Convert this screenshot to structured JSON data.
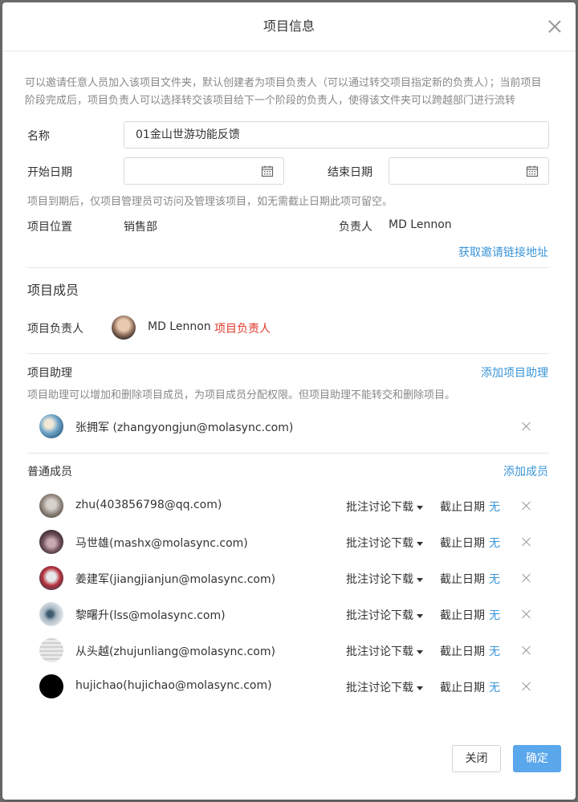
{
  "dialog": {
    "title": "项目信息",
    "intro": "可以邀请任意人员加入该项目文件夹，默认创建者为项目负责人（可以通过转交项目指定新的负责人）；当前项目阶段完成后，项目负责人可以选择转交该项目给下一个阶段的负责人，使得该文件夹可以跨越部门进行流转"
  },
  "form": {
    "name_label": "名称",
    "name_value": "01金山世游功能反馈",
    "start_label": "开始日期",
    "end_label": "结束日期",
    "date_hint": "项目到期后，仅项目管理员可访问及管理该项目，如无需截止日期此项可留空。",
    "location_label": "项目位置",
    "location_value": "销售部",
    "owner_label": "负责人",
    "owner_value": "MD Lennon",
    "invite_link": "获取邀请链接地址"
  },
  "members": {
    "section_title": "项目成员",
    "owner_row_label": "项目负责人",
    "owner_name": "MD Lennon",
    "owner_tag": "项目负责人",
    "assistant_title": "项目助理",
    "assistant_add": "添加项目助理",
    "assistant_hint": "项目助理可以增加和删除项目成员，为项目成员分配权限。但项目助理不能转交和删除项目。",
    "assistants": [
      {
        "display": "张拥军   (zhangyongjun@molasync.com)"
      }
    ],
    "regular_title": "普通成员",
    "regular_add": "添加成员",
    "deadline_label": "截止日期",
    "deadline_none": "无",
    "permission": "批注讨论下载",
    "regular": [
      {
        "display": "zhu(403856798@qq.com)"
      },
      {
        "display": "马世雄(mashx@molasync.com)"
      },
      {
        "display": "姜建军(jiangjianjun@molasync.com)"
      },
      {
        "display": "黎曙升(lss@molasync.com)"
      },
      {
        "display": "从头越(zhujunliang@molasync.com)"
      },
      {
        "display": "hujichao(hujichao@molasync.com)"
      }
    ]
  },
  "footer": {
    "close_label": "关闭",
    "confirm_label": "确定"
  },
  "colors": {
    "accent": "#3a95d8",
    "danger": "#e0392c",
    "primary_button": "#5aa7ec"
  }
}
